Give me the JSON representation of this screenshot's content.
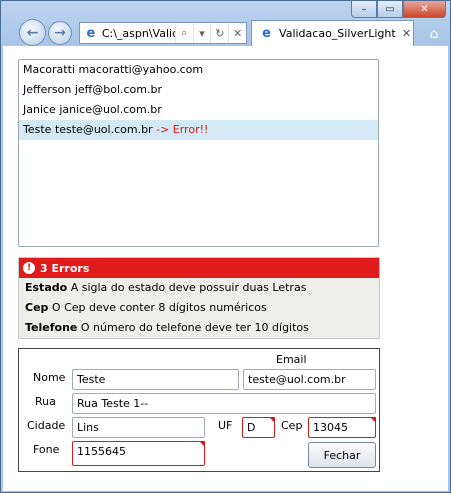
{
  "browser": {
    "address": "C:\\_aspn\\Validac",
    "tab_title": "Validacao_SilverLight",
    "caption": {
      "min": "–",
      "max": "▭",
      "close": "✕"
    }
  },
  "list": {
    "items": [
      {
        "name": "Macoratti",
        "email": "macoratti@yahoo.com",
        "error": ""
      },
      {
        "name": "Jefferson",
        "email": "jeff@bol.com.br",
        "error": ""
      },
      {
        "name": "Janice",
        "email": "janice@uol.com.br",
        "error": ""
      },
      {
        "name": "Teste",
        "email": "teste@uol.com.br",
        "error": "-> Error!!"
      }
    ],
    "selected_index": 3
  },
  "errors": {
    "header": "3 Errors",
    "items": [
      {
        "field": "Estado",
        "message": "A sigla do estado deve possuir duas Letras"
      },
      {
        "field": "Cep",
        "message": "O Cep deve conter 8 dígitos numéricos"
      },
      {
        "field": "Telefone",
        "message": "O número do telefone deve ter 10 dígitos"
      }
    ]
  },
  "form": {
    "labels": {
      "email": "Email",
      "nome": "Nome",
      "rua": "Rua",
      "cidade": "Cidade",
      "uf": "UF",
      "cep": "Cep",
      "fone": "Fone"
    },
    "values": {
      "nome": "Teste",
      "email": "teste@uol.com.br",
      "rua": "Rua Teste 1--",
      "cidade": "Lins",
      "uf": "D",
      "cep": "13045",
      "fone": "1155645"
    },
    "close_button": "Fechar"
  },
  "colors": {
    "error": "#e01b1b",
    "selection": "#d3e9f3"
  }
}
